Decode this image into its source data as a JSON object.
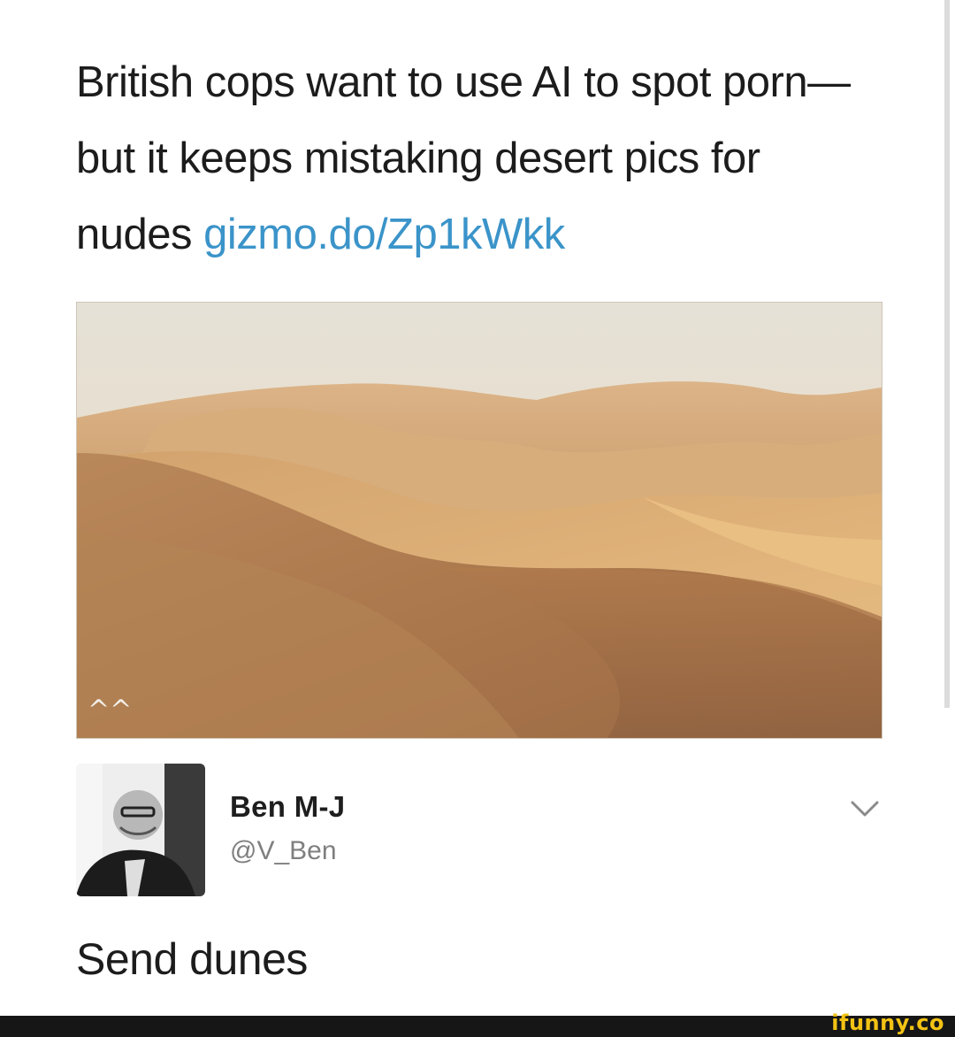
{
  "post": {
    "headline_text": "British cops want to use AI to spot porn—but it keeps mistaking desert pics for nudes ",
    "headline_link": "gizmo.do/Zp1kWkk",
    "link_color": "#3b94c9"
  },
  "media": {
    "description_icon": "desert-dunes-photo",
    "mark_icon": "mm-mark-icon"
  },
  "author": {
    "name": "Ben M-J",
    "handle": "@V_Ben",
    "menu_icon": "chevron-down-icon"
  },
  "reply": {
    "text": "Send dunes"
  },
  "footer": {
    "watermark": "ifunny.co",
    "watermark_color": "#f3c214"
  }
}
